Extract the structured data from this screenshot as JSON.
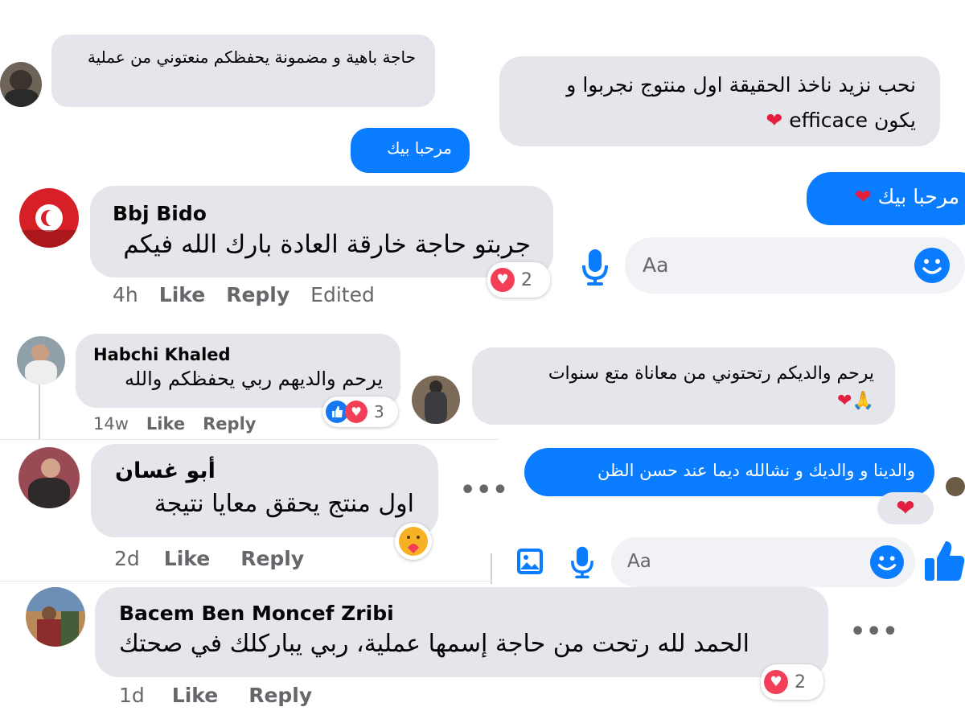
{
  "chat1": {
    "received": "حاجة باهية و مضمونة يحفظكم منعتوني من عملية",
    "sent_reply": "مرحبا بيك",
    "right_msg_line1": "نحب نزيد ناخذ الحقيقة اول منتوج نجربوا و",
    "right_msg_line2": "يكون efficace",
    "sent_right": "مرحبا بيك",
    "input_placeholder": "Aa"
  },
  "comment1": {
    "author": "Bbj Bido",
    "text": "جربتو حاجة خارقة العادة بارك الله فيكم",
    "time": "4h",
    "like": "Like",
    "reply": "Reply",
    "edited": "Edited",
    "reactions": "2"
  },
  "comment2": {
    "author": "Habchi Khaled",
    "text": "يرحم والديهم ربي يحفظكم والله",
    "time": "14w",
    "like": "Like",
    "reply": "Reply",
    "reactions": "3"
  },
  "chat2": {
    "received_line1": "يرحم والديكم رتحتوني من معاناة متع سنوات",
    "sent": "والدينا و والديك و نشالله ديما عند حسن الظن",
    "input_placeholder": "Aa"
  },
  "comment3": {
    "author": "أبو غسان",
    "text": "اول منتج يحقق معايا نتيجة",
    "time": "2d",
    "like": "Like",
    "reply": "Reply"
  },
  "comment4": {
    "author": "Bacem Ben Moncef Zribi",
    "text": "الحمد لله رتحت من حاجة إسمها عملية، ربي يباركلك في صحتك",
    "time": "1d",
    "like": "Like",
    "reply": "Reply",
    "reactions": "2"
  },
  "colors": {
    "messenger_blue": "#0a7cff",
    "bubble_gray": "#e4e6eb",
    "heart_red": "#f33e58",
    "meta_gray": "#65676b"
  },
  "icons": [
    "microphone-icon",
    "smile-icon",
    "image-icon",
    "thumbs-up-icon",
    "more-dots-icon",
    "heart-icon",
    "care-icon"
  ]
}
